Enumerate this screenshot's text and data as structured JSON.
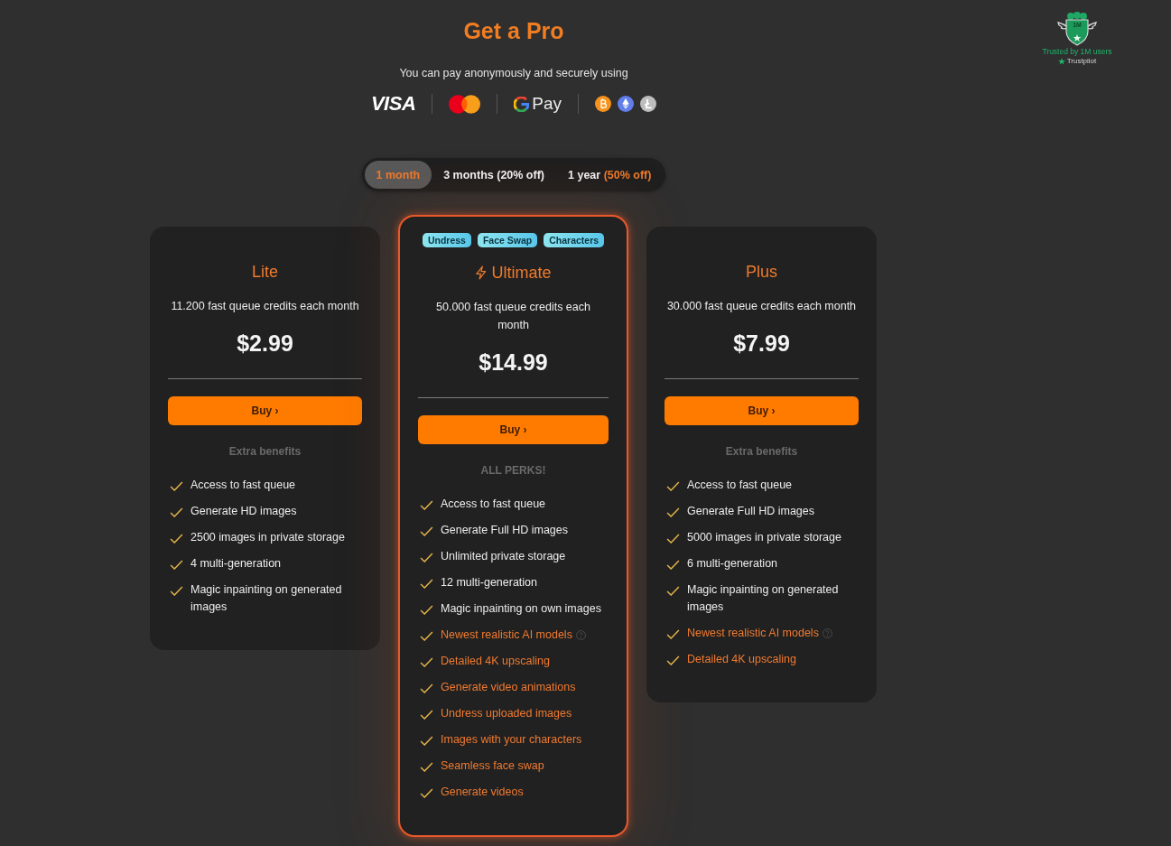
{
  "trust_badge": {
    "emblem": "1M",
    "text": "Trusted by 1M users",
    "source": "Trustpilot"
  },
  "header": {
    "title": "Get a Pro",
    "subtitle": "You can pay anonymously and securely using"
  },
  "payment_methods": [
    {
      "kind": "visa",
      "label": "VISA"
    },
    {
      "kind": "mastercard"
    },
    {
      "kind": "gpay",
      "label": "Pay"
    },
    {
      "kind": "crypto"
    }
  ],
  "billing_periods": [
    {
      "label": "1 month",
      "selected": true
    },
    {
      "label": "3 months (20% off)",
      "selected": false
    },
    {
      "label": "1 year",
      "discount": "(50% off)",
      "selected": false
    }
  ],
  "plans": [
    {
      "name": "Lite",
      "featured": false,
      "credits": "11.200 fast queue credits each month",
      "price": "$2.99",
      "button": "Buy ›",
      "benefits_heading": "Extra benefits",
      "features": [
        {
          "text": "Access to fast queue",
          "premium": false,
          "info": false
        },
        {
          "text": "Generate HD images",
          "premium": false,
          "info": false
        },
        {
          "text": "2500 images in private storage",
          "premium": false,
          "info": false
        },
        {
          "text": "4 multi-generation",
          "premium": false,
          "info": false
        },
        {
          "text": "Magic inpainting on generated images",
          "premium": false,
          "info": false
        }
      ]
    },
    {
      "name": "Ultimate",
      "featured": true,
      "tags": [
        "Undress",
        "Face Swap",
        "Characters"
      ],
      "credits": "50.000 fast queue credits each month",
      "price": "$14.99",
      "button": "Buy ›",
      "benefits_heading": "ALL PERKS!",
      "features": [
        {
          "text": "Access to fast queue",
          "premium": false,
          "info": false
        },
        {
          "text": "Generate Full HD images",
          "premium": false,
          "info": false
        },
        {
          "text": "Unlimited private storage",
          "premium": false,
          "info": false
        },
        {
          "text": "12 multi-generation",
          "premium": false,
          "info": false
        },
        {
          "text": "Magic inpainting on own images",
          "premium": false,
          "info": false
        },
        {
          "text": "Newest realistic AI models",
          "premium": true,
          "info": true
        },
        {
          "text": "Detailed 4K upscaling",
          "premium": true,
          "info": false
        },
        {
          "text": "Generate video animations",
          "premium": true,
          "info": false
        },
        {
          "text": "Undress uploaded images",
          "premium": true,
          "info": false
        },
        {
          "text": "Images with your characters",
          "premium": true,
          "info": false
        },
        {
          "text": "Seamless face swap",
          "premium": true,
          "info": false
        },
        {
          "text": "Generate videos",
          "premium": true,
          "info": false
        }
      ]
    },
    {
      "name": "Plus",
      "featured": false,
      "credits": "30.000 fast queue credits each month",
      "price": "$7.99",
      "button": "Buy ›",
      "benefits_heading": "Extra benefits",
      "features": [
        {
          "text": "Access to fast queue",
          "premium": false,
          "info": false
        },
        {
          "text": "Generate Full HD images",
          "premium": false,
          "info": false
        },
        {
          "text": "5000 images in private storage",
          "premium": false,
          "info": false
        },
        {
          "text": "6 multi-generation",
          "premium": false,
          "info": false
        },
        {
          "text": "Magic inpainting on generated images",
          "premium": false,
          "info": false
        },
        {
          "text": "Newest realistic AI models",
          "premium": true,
          "info": true
        },
        {
          "text": "Detailed 4K upscaling",
          "premium": true,
          "info": false
        }
      ]
    }
  ]
}
